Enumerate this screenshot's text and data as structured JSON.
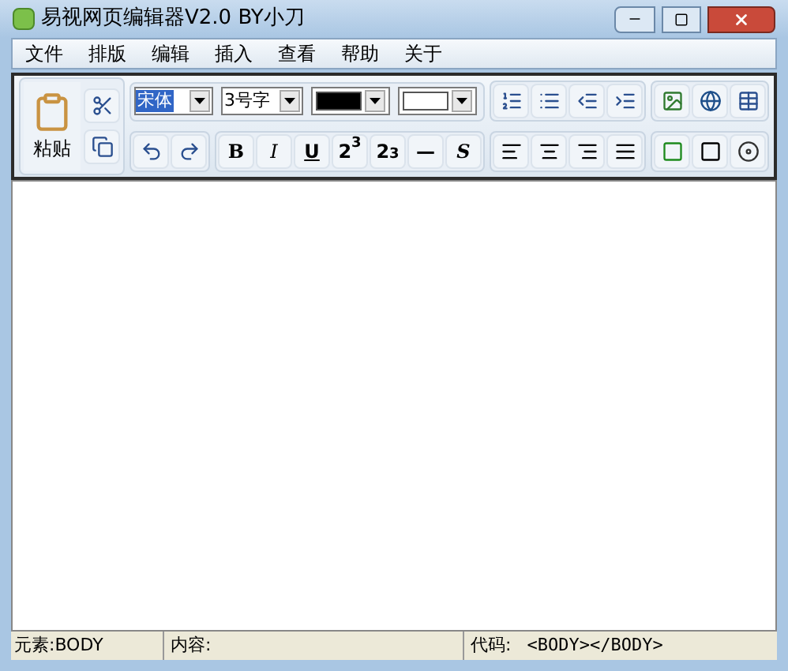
{
  "window": {
    "title": "易视网页编辑器V2.0 BY小刀"
  },
  "menu": [
    "文件",
    "排版",
    "编辑",
    "插入",
    "查看",
    "帮助",
    "关于"
  ],
  "toolbar": {
    "paste_label": "粘贴",
    "font": "宋体",
    "size": "3号字",
    "text_color": {
      "color": "#000000"
    },
    "back_color": {
      "color": "#ffffff"
    },
    "format_buttons": [
      "B",
      "I",
      "U",
      "2$^{3}$",
      "2$_{3}$",
      "—",
      "S"
    ]
  },
  "status_bar": {
    "element": "元素:BODY",
    "content": "内容:",
    "code_label": "代码:",
    "code": "<BODY></BODY>"
  }
}
